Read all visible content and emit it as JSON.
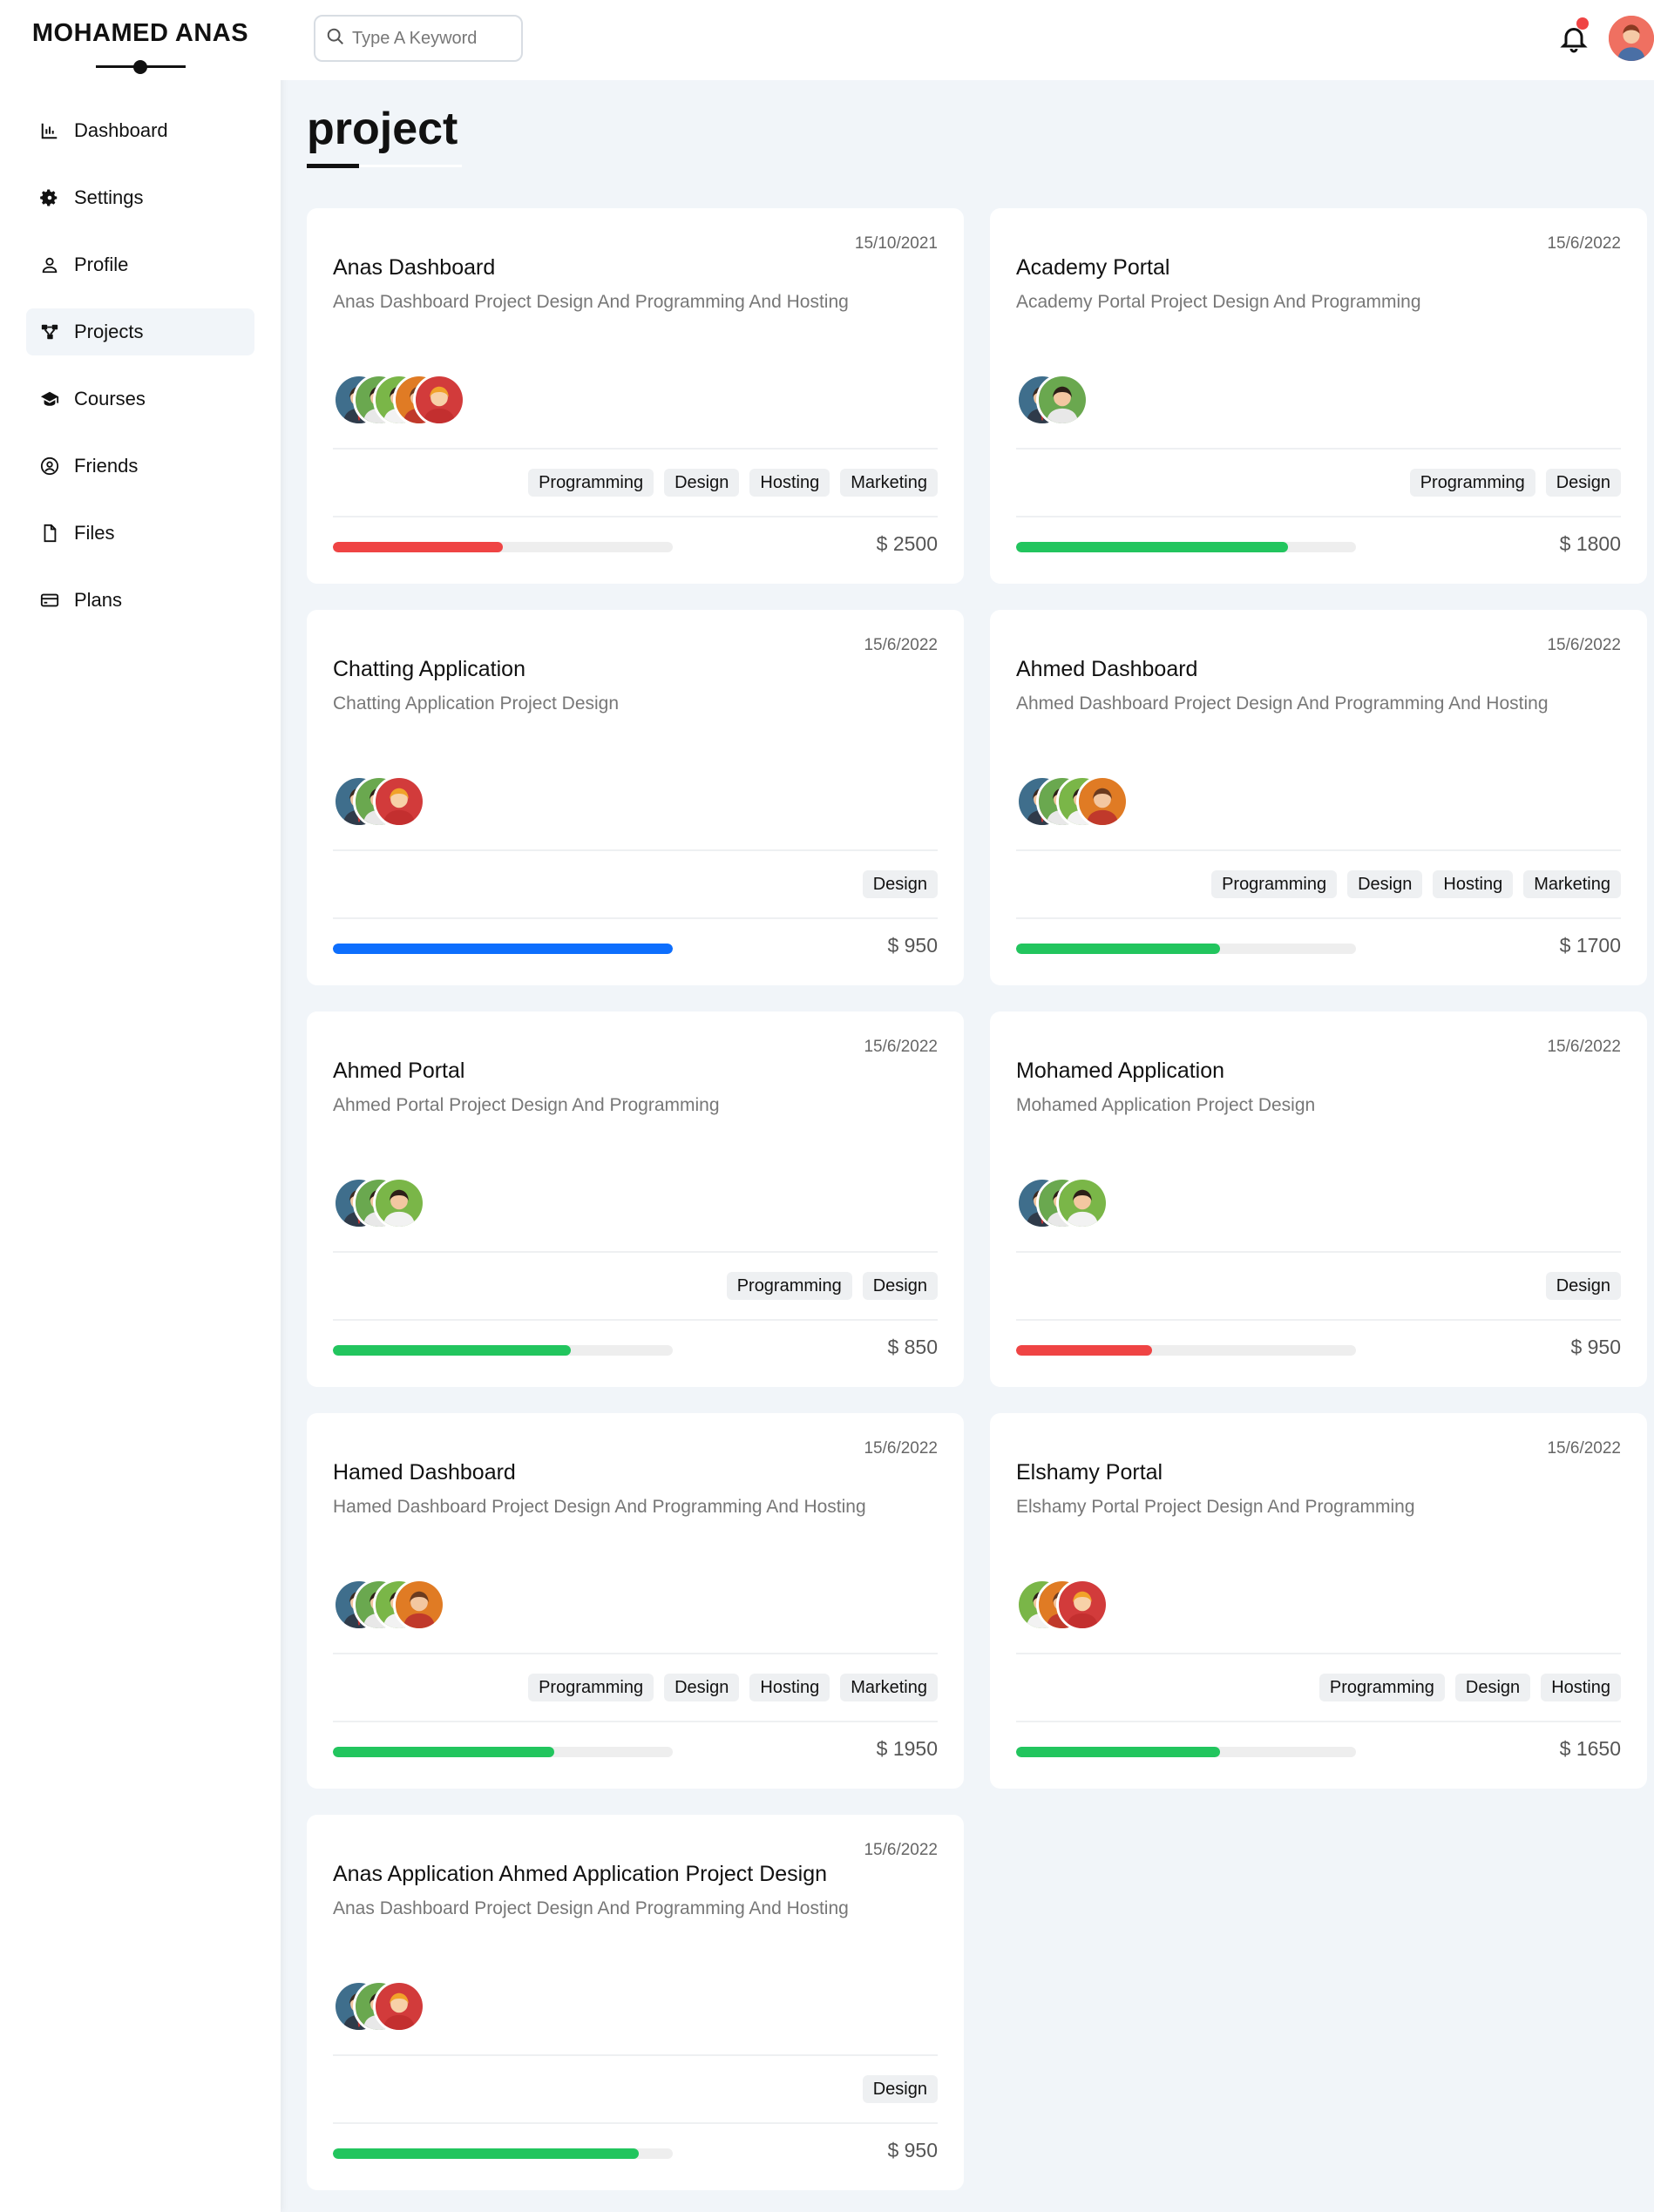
{
  "sidebar": {
    "brand": "MOHAMED ANAS",
    "items": [
      {
        "label": "Dashboard",
        "icon": "chart-icon"
      },
      {
        "label": "Settings",
        "icon": "gear-icon"
      },
      {
        "label": "Profile",
        "icon": "user-icon"
      },
      {
        "label": "Projects",
        "icon": "diagram-icon",
        "active": true
      },
      {
        "label": "Courses",
        "icon": "graduation-cap-icon"
      },
      {
        "label": "Friends",
        "icon": "user-circle-icon"
      },
      {
        "label": "Files",
        "icon": "file-icon"
      },
      {
        "label": "Plans",
        "icon": "credit-card-icon"
      }
    ]
  },
  "header": {
    "search_placeholder": "Type A Keyword",
    "has_notification": true
  },
  "page": {
    "title": "project"
  },
  "colors": {
    "red": "#ef4444",
    "green": "#22c55e",
    "blue": "#0d6efd",
    "track": "#eeeeee",
    "background": "#f1f5f9"
  },
  "projects": [
    {
      "date": "15/10/2021",
      "title": "Anas Dashboard",
      "desc": "Anas Dashboard Project Design And Programming And Hosting",
      "avatars": [
        "blue-man",
        "green-woman",
        "green-man",
        "orange-woman",
        "red-woman"
      ],
      "tags": [
        "Programming",
        "Design",
        "Hosting",
        "Marketing"
      ],
      "progress": 0.5,
      "color": "red",
      "price": "$ 2500"
    },
    {
      "date": "15/6/2022",
      "title": "Academy Portal",
      "desc": "Academy Portal Project Design And Programming",
      "avatars": [
        "blue-man",
        "green-woman"
      ],
      "tags": [
        "Programming",
        "Design"
      ],
      "progress": 0.8,
      "color": "green",
      "price": "$ 1800"
    },
    {
      "date": "15/6/2022",
      "title": "Chatting Application",
      "desc": "Chatting Application Project Design",
      "avatars": [
        "blue-man",
        "green-woman",
        "red-woman"
      ],
      "tags": [
        "Design"
      ],
      "progress": 1.0,
      "color": "blue",
      "price": "$ 950"
    },
    {
      "date": "15/6/2022",
      "title": "Ahmed Dashboard",
      "desc": "Ahmed Dashboard Project Design And Programming And Hosting",
      "avatars": [
        "blue-man",
        "green-woman",
        "green-man",
        "orange-woman"
      ],
      "tags": [
        "Programming",
        "Design",
        "Hosting",
        "Marketing"
      ],
      "progress": 0.6,
      "color": "green",
      "price": "$ 1700"
    },
    {
      "date": "15/6/2022",
      "title": "Ahmed Portal",
      "desc": "Ahmed Portal Project Design And Programming",
      "avatars": [
        "blue-man",
        "green-woman",
        "green-man"
      ],
      "tags": [
        "Programming",
        "Design"
      ],
      "progress": 0.7,
      "color": "green",
      "price": "$ 850"
    },
    {
      "date": "15/6/2022",
      "title": "Mohamed Application",
      "desc": "Mohamed Application Project Design",
      "avatars": [
        "blue-man",
        "green-woman",
        "green-man"
      ],
      "tags": [
        "Design"
      ],
      "progress": 0.4,
      "color": "red",
      "price": "$ 950"
    },
    {
      "date": "15/6/2022",
      "title": "Hamed Dashboard",
      "desc": "Hamed Dashboard Project Design And Programming And Hosting",
      "avatars": [
        "blue-man",
        "green-woman",
        "green-man",
        "orange-woman"
      ],
      "tags": [
        "Programming",
        "Design",
        "Hosting",
        "Marketing"
      ],
      "progress": 0.65,
      "color": "green",
      "price": "$ 1950"
    },
    {
      "date": "15/6/2022",
      "title": "Elshamy Portal",
      "desc": "Elshamy Portal Project Design And Programming",
      "avatars": [
        "green-man",
        "orange-woman",
        "red-woman"
      ],
      "tags": [
        "Programming",
        "Design",
        "Hosting"
      ],
      "progress": 0.6,
      "color": "green",
      "price": "$ 1650"
    },
    {
      "date": "15/6/2022",
      "title": "Anas Application Ahmed Application Project Design",
      "desc": "Anas Dashboard Project Design And Programming And Hosting",
      "avatars": [
        "blue-man",
        "green-woman",
        "red-woman"
      ],
      "tags": [
        "Design"
      ],
      "progress": 0.9,
      "color": "green",
      "price": "$ 950"
    }
  ]
}
